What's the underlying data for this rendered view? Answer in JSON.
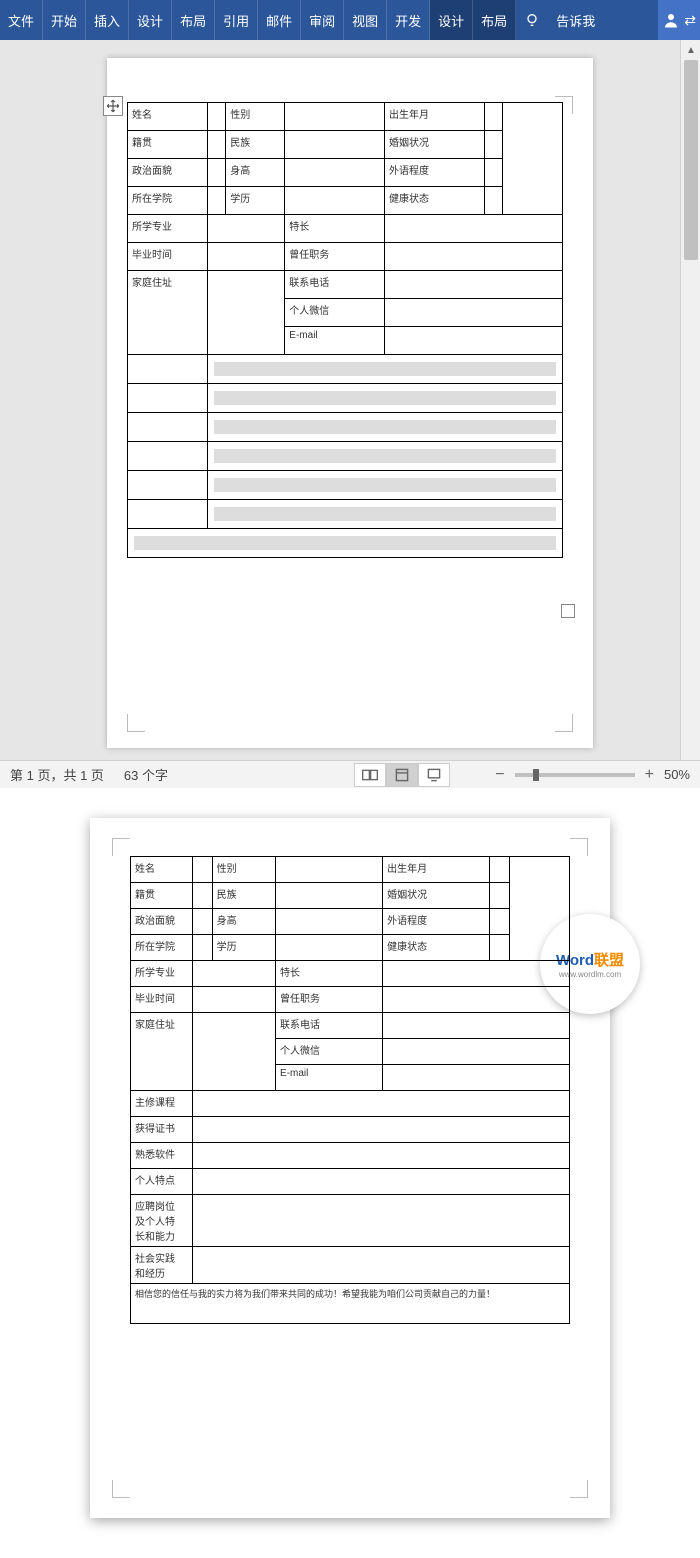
{
  "ribbon": {
    "tabs": [
      "文件",
      "开始",
      "插入",
      "设计",
      "布局",
      "引用",
      "邮件",
      "审阅",
      "视图",
      "开发",
      "设计",
      "布局"
    ],
    "tell_me": "告诉我"
  },
  "table1": {
    "r1": {
      "c1": "姓名",
      "c2": "性别",
      "c3": "出生年月"
    },
    "r2": {
      "c1": "籍贯",
      "c2": "民族",
      "c3": "婚姻状况"
    },
    "r3": {
      "c1": "政治面貌",
      "c2": "身高",
      "c3": "外语程度"
    },
    "r4": {
      "c1": "所在学院",
      "c2": "学历",
      "c3": "健康状态"
    },
    "r5": {
      "c1": "所学专业",
      "c2": "特长"
    },
    "r6": {
      "c1": "毕业时间",
      "c2": "曾任职务"
    },
    "r7": {
      "c1": "家庭住址",
      "c2": "联系电话",
      "c3": "个人微信",
      "c4": "E-mail"
    }
  },
  "status": {
    "page": "第 1 页，共 1 页",
    "words": "63 个字",
    "zoom": "50%"
  },
  "table2": {
    "r1": {
      "c1": "姓名",
      "c2": "性别",
      "c3": "出生年月"
    },
    "r2": {
      "c1": "籍贯",
      "c2": "民族",
      "c3": "婚姻状况"
    },
    "r3": {
      "c1": "政治面貌",
      "c2": "身高",
      "c3": "外语程度"
    },
    "r4": {
      "c1": "所在学院",
      "c2": "学历",
      "c3": "健康状态"
    },
    "r5": {
      "c1": "所学专业",
      "c2": "特长"
    },
    "r6": {
      "c1": "毕业时间",
      "c2": "曾任职务"
    },
    "r7": {
      "c1": "家庭住址",
      "c2": "联系电话",
      "c3": "个人微信",
      "c4": "E-mail"
    },
    "r8": "主修课程",
    "r9": "获得证书",
    "r10": "熟悉软件",
    "r11": "个人特点",
    "r12a": "应聘岗位",
    "r12b": "及个人特",
    "r12c": "长和能力",
    "r13a": "社会实践",
    "r13b": "和经历",
    "r14": "相信您的信任与我的实力将为我们带来共同的成功！希望我能为咱们公司贡献自己的力量！"
  },
  "watermark": {
    "brand1": "Word",
    "brand2": "联盟",
    "url": "www.wordlm.com"
  }
}
